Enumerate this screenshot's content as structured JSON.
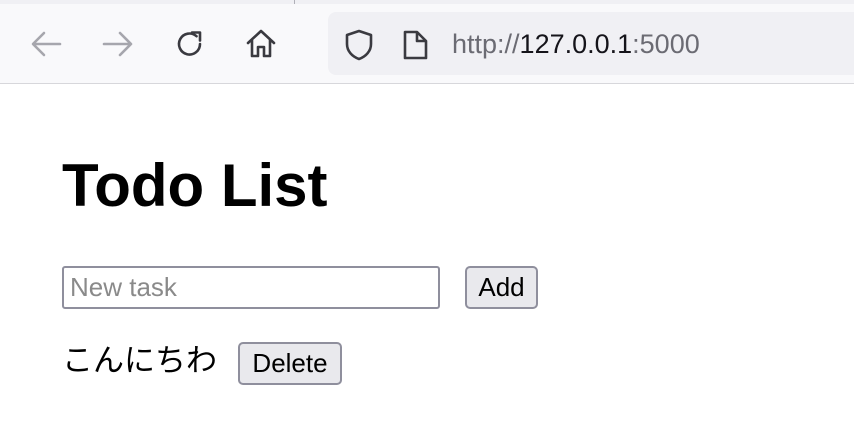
{
  "browser": {
    "url_prefix": "http://",
    "url_host": "127.0.0.1",
    "url_port": ":5000",
    "icons": [
      "back-arrow-icon",
      "forward-arrow-icon",
      "reload-icon",
      "home-icon",
      "shield-icon",
      "page-icon"
    ]
  },
  "page": {
    "title": "Todo List",
    "input": {
      "value": "",
      "placeholder": "New task"
    },
    "add_label": "Add",
    "tasks": [
      {
        "text": "こんにちわ",
        "delete_label": "Delete"
      }
    ]
  }
}
